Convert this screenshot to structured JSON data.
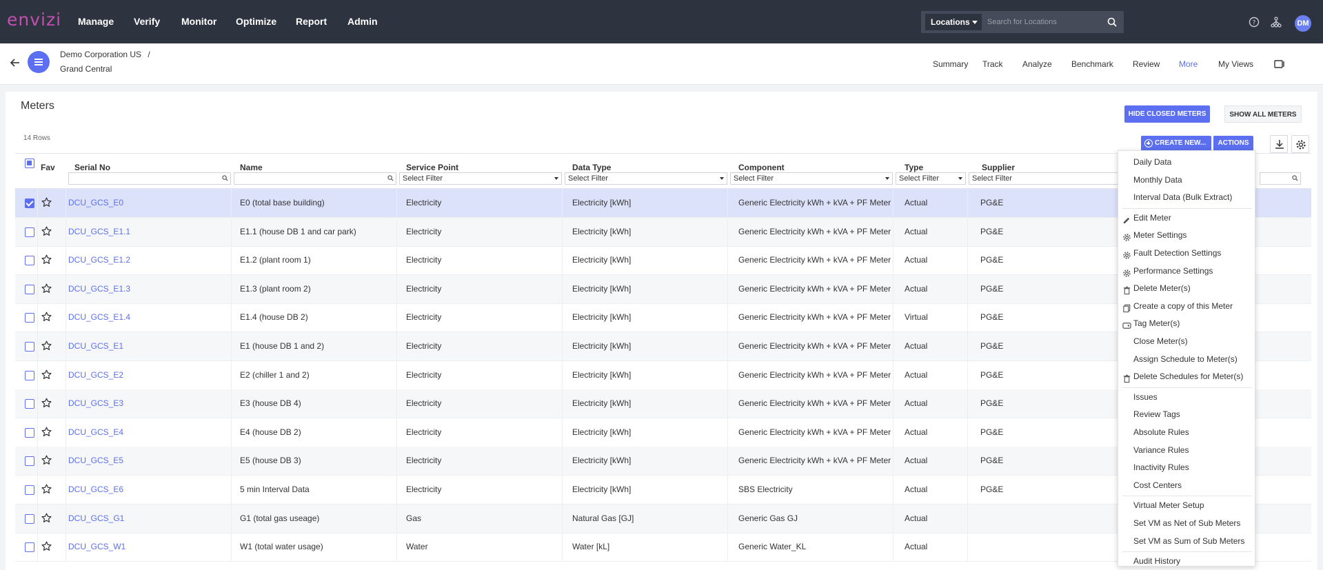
{
  "app": {
    "logo": "envizi",
    "nav": [
      "Manage",
      "Verify",
      "Monitor",
      "Optimize",
      "Report",
      "Admin"
    ],
    "location_select": "Locations",
    "search_placeholder": "Search for Locations",
    "user_initials": "DM"
  },
  "breadcrumb": {
    "org": "Demo Corporation US",
    "separator": "/",
    "site": "Grand Central"
  },
  "subnav": {
    "items": [
      "Summary",
      "Track",
      "Analyze",
      "Benchmark",
      "Review",
      "More",
      "My Views"
    ],
    "active": "More"
  },
  "page": {
    "title": "Meters",
    "hide_closed": "HIDE CLOSED METERS",
    "show_all": "SHOW ALL METERS",
    "rows_count": "14 Rows",
    "create_new": "CREATE NEW...",
    "actions": "ACTIONS"
  },
  "table": {
    "headers": [
      "Fav",
      "Serial No",
      "Name",
      "Service Point",
      "Data Type",
      "Component",
      "Type",
      "Supplier"
    ],
    "select_filter": "Select Filter",
    "rows": [
      {
        "serial": "DCU_GCS_E0",
        "name": "E0 (total base building)",
        "service": "Electricity",
        "dtype": "Electricity [kWh]",
        "component": "Generic Electricity kWh + kVA + PF Meter",
        "type": "Actual",
        "supplier": "PG&E"
      },
      {
        "serial": "DCU_GCS_E1.1",
        "name": "E1.1 (house DB 1 and car park)",
        "service": "Electricity",
        "dtype": "Electricity [kWh]",
        "component": "Generic Electricity kWh + kVA + PF Meter",
        "type": "Actual",
        "supplier": "PG&E"
      },
      {
        "serial": "DCU_GCS_E1.2",
        "name": "E1.2 (plant room 1)",
        "service": "Electricity",
        "dtype": "Electricity [kWh]",
        "component": "Generic Electricity kWh + kVA + PF Meter",
        "type": "Actual",
        "supplier": "PG&E"
      },
      {
        "serial": "DCU_GCS_E1.3",
        "name": "E1.3 (plant room 2)",
        "service": "Electricity",
        "dtype": "Electricity [kWh]",
        "component": "Generic Electricity kWh + kVA + PF Meter",
        "type": "Actual",
        "supplier": "PG&E"
      },
      {
        "serial": "DCU_GCS_E1.4",
        "name": "E1.4 (house DB 2)",
        "service": "Electricity",
        "dtype": "Electricity [kWh]",
        "component": "Generic Electricity kWh + kVA + PF Meter",
        "type": "Virtual",
        "supplier": "PG&E"
      },
      {
        "serial": "DCU_GCS_E1",
        "name": "E1 (house DB 1 and 2)",
        "service": "Electricity",
        "dtype": "Electricity [kWh]",
        "component": "Generic Electricity kWh + kVA + PF Meter",
        "type": "Actual",
        "supplier": "PG&E"
      },
      {
        "serial": "DCU_GCS_E2",
        "name": "E2 (chiller 1 and 2)",
        "service": "Electricity",
        "dtype": "Electricity [kWh]",
        "component": "Generic Electricity kWh + kVA + PF Meter",
        "type": "Actual",
        "supplier": "PG&E"
      },
      {
        "serial": "DCU_GCS_E3",
        "name": "E3 (house DB 4)",
        "service": "Electricity",
        "dtype": "Electricity [kWh]",
        "component": "Generic Electricity kWh + kVA + PF Meter",
        "type": "Actual",
        "supplier": "PG&E"
      },
      {
        "serial": "DCU_GCS_E4",
        "name": "E4 (house DB 2)",
        "service": "Electricity",
        "dtype": "Electricity [kWh]",
        "component": "Generic Electricity kWh + kVA + PF Meter",
        "type": "Actual",
        "supplier": "PG&E"
      },
      {
        "serial": "DCU_GCS_E5",
        "name": "E5 (house DB 3)",
        "service": "Electricity",
        "dtype": "Electricity [kWh]",
        "component": "Generic Electricity kWh + kVA + PF Meter",
        "type": "Actual",
        "supplier": "PG&E"
      },
      {
        "serial": "DCU_GCS_E6",
        "name": "5 min Interval Data",
        "service": "Electricity",
        "dtype": "Electricity [kWh]",
        "component": "SBS Electricity",
        "type": "Actual",
        "supplier": "PG&E"
      },
      {
        "serial": "DCU_GCS_G1",
        "name": "G1 (total gas useage)",
        "service": "Gas",
        "dtype": "Natural Gas [GJ]",
        "component": "Generic Gas GJ",
        "type": "Actual",
        "supplier": ""
      },
      {
        "serial": "DCU_GCS_W1",
        "name": "W1 (total water usage)",
        "service": "Water",
        "dtype": "Water [kL]",
        "component": "Generic Water_KL",
        "type": "Actual",
        "supplier": ""
      }
    ]
  },
  "actions_menu": {
    "groups": [
      [
        {
          "label": "Daily Data",
          "icon": ""
        },
        {
          "label": "Monthly Data",
          "icon": ""
        },
        {
          "label": "Interval Data (Bulk Extract)",
          "icon": ""
        }
      ],
      [
        {
          "label": "Edit Meter",
          "icon": "pencil-icon"
        },
        {
          "label": "Meter Settings",
          "icon": "gear-icon"
        },
        {
          "label": "Fault Detection Settings",
          "icon": "gear-icon"
        },
        {
          "label": "Performance Settings",
          "icon": "gear-icon"
        },
        {
          "label": "Delete Meter(s)",
          "icon": "trash-icon"
        },
        {
          "label": "Create a copy of this Meter",
          "icon": "copy-icon"
        },
        {
          "label": "Tag Meter(s)",
          "icon": "tag-icon"
        },
        {
          "label": "Close Meter(s)",
          "icon": ""
        },
        {
          "label": "Assign Schedule to Meter(s)",
          "icon": ""
        },
        {
          "label": "Delete Schedules for Meter(s)",
          "icon": "trash-icon"
        }
      ],
      [
        {
          "label": "Issues",
          "icon": ""
        },
        {
          "label": "Review Tags",
          "icon": ""
        },
        {
          "label": "Absolute Rules",
          "icon": ""
        },
        {
          "label": "Variance Rules",
          "icon": ""
        },
        {
          "label": "Inactivity Rules",
          "icon": ""
        },
        {
          "label": "Cost Centers",
          "icon": ""
        }
      ],
      [
        {
          "label": "Virtual Meter Setup",
          "icon": ""
        },
        {
          "label": "Set VM as Net of Sub Meters",
          "icon": ""
        },
        {
          "label": "Set VM as Sum of Sub Meters",
          "icon": ""
        }
      ],
      [
        {
          "label": "Audit History",
          "icon": ""
        }
      ]
    ]
  },
  "colors": {
    "accent": "#5b6ff0",
    "topbar": "#2e3340",
    "logo": "#c34fb0",
    "selected_row": "#dde2fb"
  }
}
